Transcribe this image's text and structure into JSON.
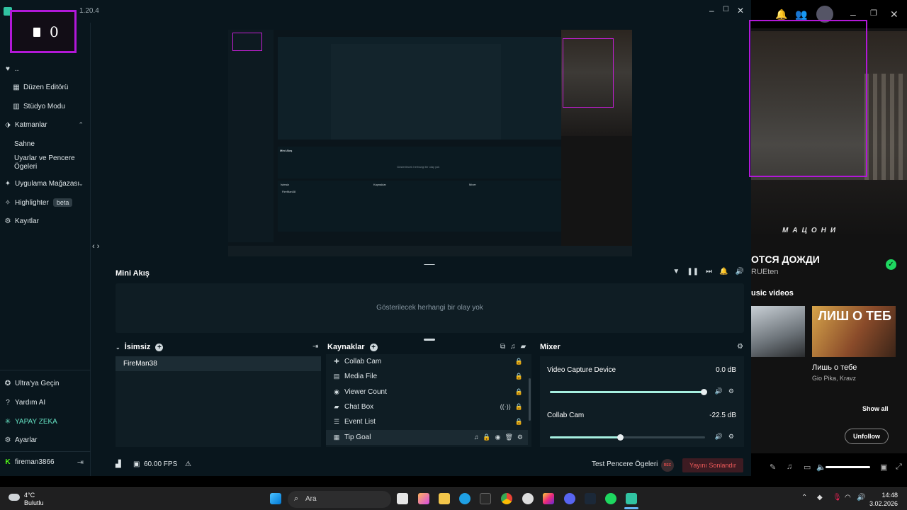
{
  "app": {
    "title": "Streamlabs Desktop 1.20.4",
    "title_visible": "1.20.4"
  },
  "overlay": {
    "counter_value": "0"
  },
  "sidebar": {
    "top_items": [
      {
        "label": "..",
        "icon": "heart-icon"
      },
      {
        "label": "Düzen Editörü",
        "icon": "grid-icon"
      },
      {
        "label": "Stüdyo Modu",
        "icon": "columns-icon"
      }
    ],
    "sections": [
      {
        "label": "Katmanlar",
        "icon": "layers-icon"
      },
      {
        "label": "Sahne"
      },
      {
        "label": "Uyarlar ve Pencere Ögeleri"
      },
      {
        "label": "Uygulama Mağazası",
        "icon": "store-icon"
      },
      {
        "label": "Highlighter",
        "badge": "beta",
        "icon": "highlighter-icon"
      },
      {
        "label": "Kayıtlar",
        "icon": "recordings-icon"
      }
    ],
    "bottom_items": [
      {
        "label": "Ultra'ya Geçin",
        "icon": "ultra-icon"
      },
      {
        "label": "Yardım AI",
        "icon": "help-icon"
      },
      {
        "label": "YAPAY ZEKA",
        "icon": "ai-icon"
      },
      {
        "label": "Ayarlar",
        "icon": "gear-icon"
      },
      {
        "label": "fireman3866",
        "icon": "kick-logo-icon"
      }
    ]
  },
  "mini_feed": {
    "title": "Mini Akış",
    "empty_text": "Gösterilecek herhangi bir olay yok"
  },
  "scenes": {
    "title": "İsimsiz",
    "items": [
      "FireMan38"
    ]
  },
  "sources": {
    "title": "Kaynaklar",
    "items": [
      {
        "label": "Collab Cam",
        "icon": "puzzle-icon"
      },
      {
        "label": "Media File",
        "icon": "file-icon"
      },
      {
        "label": "Viewer Count",
        "icon": "eye-icon"
      },
      {
        "label": "Chat Box",
        "icon": "chat-icon"
      },
      {
        "label": "Event List",
        "icon": "list-icon"
      },
      {
        "label": "Tip Goal",
        "icon": "goal-icon"
      }
    ]
  },
  "mixer": {
    "title": "Mixer",
    "channels": [
      {
        "name": "Video Capture Device",
        "db": "0.0 dB",
        "level": 0.99
      },
      {
        "name": "Collab Cam",
        "db": "-22.5 dB",
        "level": 0.45
      }
    ]
  },
  "statusbar": {
    "fps": "60.00 FPS",
    "test_widgets": "Test Pencere Ögeleri",
    "rec_label": "REC",
    "end_stream": "Yayını Sonlandır"
  },
  "preview": {
    "mini_title": "Mini Akış",
    "mini_empty": "Gösterilecek herhangi bir olay yok",
    "scene_title": "İsimsiz",
    "scene_item": "FireMan38",
    "sources_title": "Kaynaklar",
    "mixer_title": "Mixer"
  },
  "spotify": {
    "song": "ОТСЯ ДОЖДИ",
    "artist": "RUEten",
    "brand": "МАЦОНИ",
    "section": "usic videos",
    "video_title": "Лишь о тебе",
    "video_artist": "Gio Pika, Kravz",
    "thumb_text": "ЛИШ О ТЕБ",
    "show_all": "Show all",
    "unfollow": "Unfollow"
  },
  "taskbar": {
    "temp": "4°C",
    "condition": "Bulutlu",
    "search_placeholder": "Ara",
    "time": "14:48",
    "date": "3.02.2026"
  },
  "colors": {
    "accent": "#31c3a2",
    "magenta": "#b218d8",
    "end_stream_bg": "#3d1b22",
    "spotify_green": "#1ed760"
  }
}
